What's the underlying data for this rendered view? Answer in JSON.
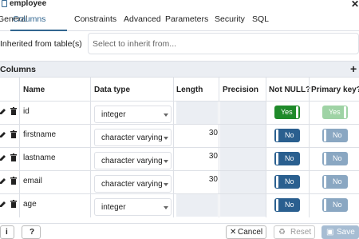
{
  "dialog": {
    "title": "employee"
  },
  "tabs": [
    "General",
    "Columns",
    "Constraints",
    "Advanced",
    "Parameters",
    "Security",
    "SQL"
  ],
  "active_tab": "Columns",
  "inherit": {
    "label": "Inherited from table(s)",
    "placeholder": "Select to inherit from..."
  },
  "columns_section": {
    "title": "Columns",
    "add": "+"
  },
  "table": {
    "headers": {
      "name": "Name",
      "data_type": "Data type",
      "length": "Length",
      "precision": "Precision",
      "not_null": "Not NULL?",
      "primary_key": "Primary key?"
    },
    "rows": [
      {
        "name": "id",
        "data_type": "integer",
        "length": "",
        "precision": "",
        "not_null": "Yes",
        "primary_key": "Yes"
      },
      {
        "name": "firstname",
        "data_type": "character varying",
        "length": "30",
        "precision": "",
        "not_null": "No",
        "primary_key": "No"
      },
      {
        "name": "lastname",
        "data_type": "character varying",
        "length": "30",
        "precision": "",
        "not_null": "No",
        "primary_key": "No"
      },
      {
        "name": "email",
        "data_type": "character varying",
        "length": "30",
        "precision": "",
        "not_null": "No",
        "primary_key": "No"
      },
      {
        "name": "age",
        "data_type": "integer",
        "length": "",
        "precision": "",
        "not_null": "No",
        "primary_key": "No"
      }
    ]
  },
  "footer": {
    "info": "i",
    "help": "?",
    "cancel": "Cancel",
    "reset": "Reset",
    "save": "Save"
  },
  "colors": {
    "accent": "#326690",
    "yes": "#1f8a2a",
    "no": "#2a5f8f",
    "header_bg": "#ebeef3"
  }
}
